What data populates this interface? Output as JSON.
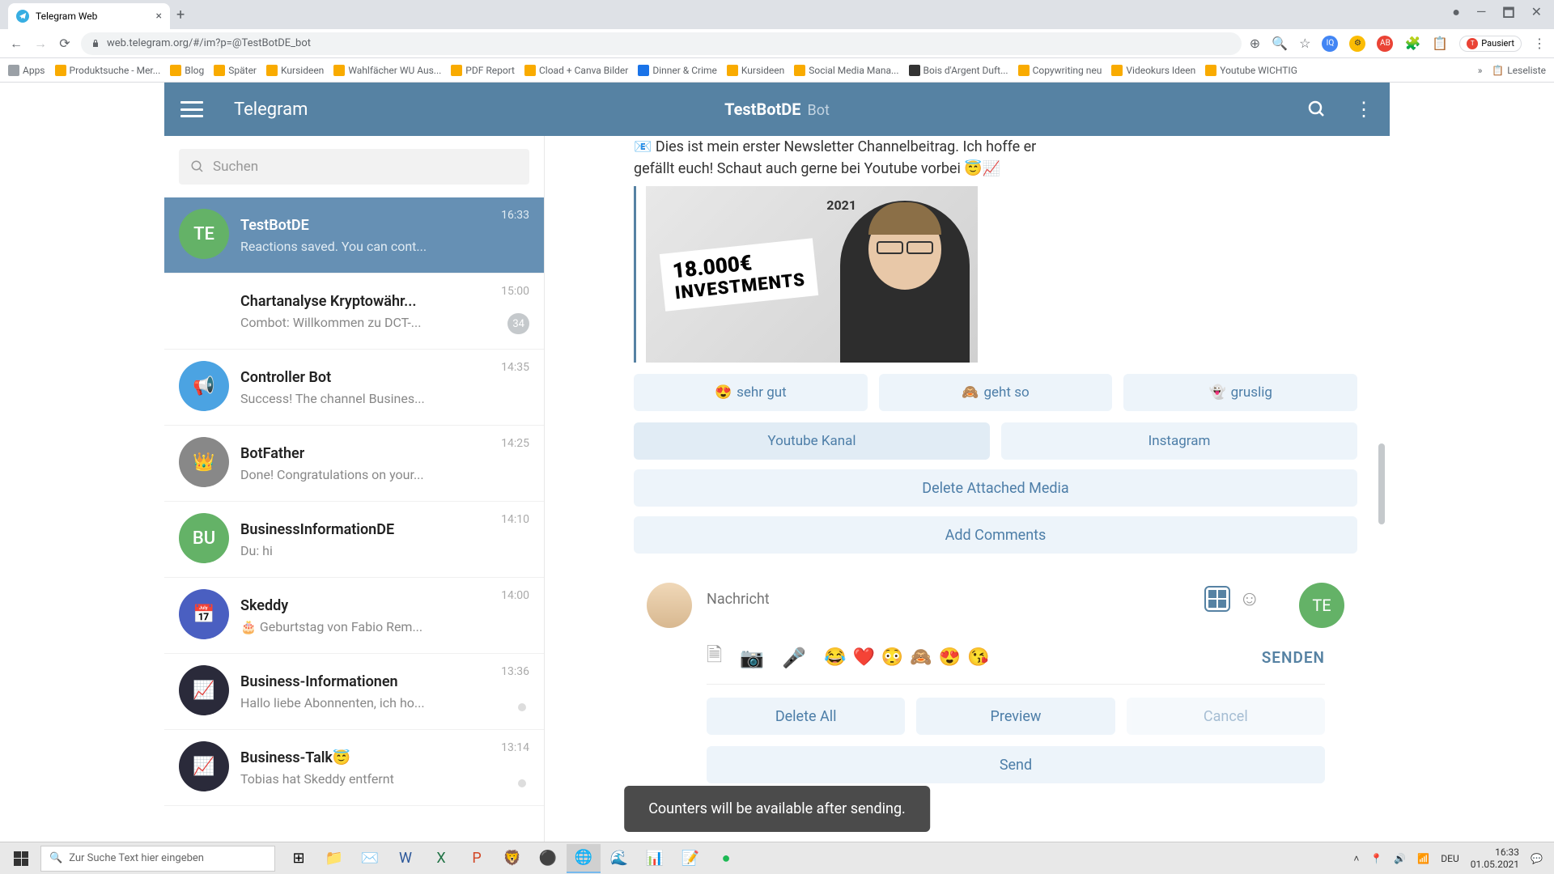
{
  "browser": {
    "tab_title": "Telegram Web",
    "url": "web.telegram.org/#/im?p=@TestBotDE_bot",
    "pausiert": "Pausiert"
  },
  "bookmarks": [
    "Apps",
    "Produktsuche - Mer...",
    "Blog",
    "Später",
    "Kursideen",
    "Wahlfächer WU Aus...",
    "PDF Report",
    "Cload + Canva Bilder",
    "Dinner & Crime",
    "Kursideen",
    "Social Media Mana...",
    "Bois d'Argent Duft...",
    "Copywriting neu",
    "Videokurs Ideen",
    "Youtube WICHTIG"
  ],
  "bookmarks_right": "Leseliste",
  "header": {
    "app_title": "Telegram",
    "chat_title": "TestBotDE",
    "chat_subtitle": "Bot"
  },
  "search_placeholder": "Suchen",
  "chats": [
    {
      "initials": "TE",
      "color": "#64b267",
      "name": "TestBotDE",
      "preview": "Reactions saved. You can cont...",
      "time": "16:33",
      "active": true
    },
    {
      "initials": "",
      "color": "#fff",
      "name": "Chartanalyse Kryptowähr...",
      "preview": "Combot: Willkommen zu DCT-...",
      "time": "15:00",
      "badge": "34",
      "img": "dct"
    },
    {
      "initials": "",
      "color": "#4ba3e2",
      "name": "Controller Bot",
      "preview": "Success! The channel Busines...",
      "time": "14:35",
      "img": "speaker"
    },
    {
      "initials": "",
      "color": "#888",
      "name": "BotFather",
      "preview": "Done! Congratulations on your...",
      "time": "14:25",
      "img": "botfather"
    },
    {
      "initials": "BU",
      "color": "#64b267",
      "name": "BusinessInformationDE",
      "preview": "Du: hi",
      "time": "14:10"
    },
    {
      "initials": "",
      "color": "#4a5fc1",
      "name": "Skeddy",
      "preview": "🎂 Geburtstag von Fabio Rem...",
      "time": "14:00",
      "img": "calendar"
    },
    {
      "initials": "",
      "color": "#2a2a3a",
      "name": "Business-Informationen",
      "preview": "Hallo liebe Abonnenten, ich ho...",
      "time": "13:36",
      "dot": true,
      "img": "chart"
    },
    {
      "initials": "",
      "color": "#2a2a3a",
      "name": "Business-Talk😇",
      "preview": "Tobias hat Skeddy entfernt",
      "time": "13:14",
      "dot": true,
      "img": "chart"
    }
  ],
  "message": {
    "text_line1": "📧 Dies ist mein erster Newsletter Channelbeitrag. Ich hoffe er",
    "text_line2": "gefällt euch! Schaut auch gerne bei Youtube vorbei 😇📈",
    "thumb_big": "18.000€",
    "thumb_sub": "INVESTMENTS",
    "thumb_year": "2021"
  },
  "reactions": [
    {
      "emoji": "😍",
      "label": "sehr gut"
    },
    {
      "emoji": "🙈",
      "label": "geht so"
    },
    {
      "emoji": "👻",
      "label": "gruslig"
    }
  ],
  "link_buttons": [
    "Youtube Kanal",
    "Instagram"
  ],
  "action_buttons": [
    "Delete Attached Media",
    "Add Comments"
  ],
  "compose": {
    "placeholder": "Nachricht",
    "send": "SENDEN",
    "avatar_initials": "TE"
  },
  "toolbar_emojis": [
    "😂",
    "❤️",
    "😳",
    "🙈",
    "😍",
    "😘"
  ],
  "bottom_buttons": [
    "Delete All",
    "Preview",
    "Cancel",
    "Send"
  ],
  "toast": "Counters will be available after sending.",
  "taskbar": {
    "search_placeholder": "Zur Suche Text hier eingeben",
    "lang": "DEU",
    "time": "16:33",
    "date": "01.05.2021"
  }
}
